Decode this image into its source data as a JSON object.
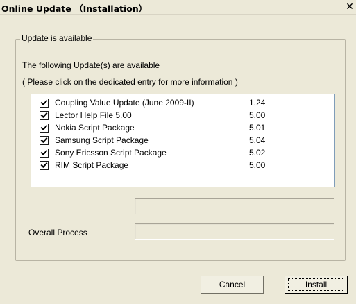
{
  "window": {
    "title": "Online Update （Installation）",
    "close_glyph": "✕",
    "close_icon": "close-icon"
  },
  "group": {
    "legend": "Update is available",
    "intro": "The following Update(s) are available",
    "hint": "( Please click on the dedicated entry for more information )"
  },
  "updates": [
    {
      "name": "Coupling Value Update (June 2009-II)",
      "version": "1.24",
      "checked": true
    },
    {
      "name": "Lector Help File 5.00",
      "version": "5.00",
      "checked": true
    },
    {
      "name": "Nokia Script Package",
      "version": "5.01",
      "checked": true
    },
    {
      "name": "Samsung Script Package",
      "version": "5.04",
      "checked": true
    },
    {
      "name": "Sony Ericsson Script Package",
      "version": "5.02",
      "checked": true
    },
    {
      "name": "RIM Script Package",
      "version": "5.00",
      "checked": true
    }
  ],
  "progress": {
    "file_value": 0,
    "overall_label": "Overall Process",
    "overall_value": 0
  },
  "buttons": {
    "cancel": "Cancel",
    "install": "Install"
  }
}
